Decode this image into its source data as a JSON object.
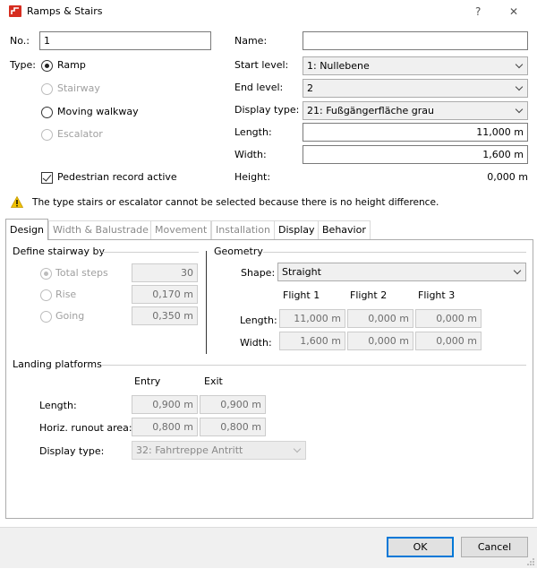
{
  "window": {
    "title": "Ramps & Stairs",
    "help_glyph": "?",
    "close_glyph": "✕"
  },
  "no": {
    "label": "No.:",
    "value": "1"
  },
  "type": {
    "label": "Type:",
    "options": [
      "Ramp",
      "Stairway",
      "Moving walkway",
      "Escalator"
    ],
    "selected": "Ramp"
  },
  "pedestrian": {
    "label": "Pedestrian record active",
    "checked": true
  },
  "right": {
    "name_label": "Name:",
    "name_value": "",
    "start_label": "Start level:",
    "start_value": "1: Nullebene",
    "end_label": "End level:",
    "end_value": "2",
    "display_label": "Display type:",
    "display_value": "21: Fußgängerfläche grau",
    "length_label": "Length:",
    "length_value": "11,000 m",
    "width_label": "Width:",
    "width_value": "1,600 m",
    "height_label": "Height:",
    "height_value": "0,000 m"
  },
  "warning": {
    "icon": "warning-icon",
    "text": "The type stairs or escalator cannot be selected because there is no height difference."
  },
  "tabs": [
    "Design",
    "Width & Balustrade",
    "Movement",
    "Installation",
    "Display",
    "Behavior"
  ],
  "active_tab": "Design",
  "define": {
    "title": "Define stairway by",
    "total_steps_label": "Total steps",
    "total_steps_value": "30",
    "rise_label": "Rise",
    "rise_value": "0,170 m",
    "going_label": "Going",
    "going_value": "0,350 m"
  },
  "geometry": {
    "title": "Geometry",
    "shape_label": "Shape:",
    "shape_value": "Straight",
    "flight_headers": [
      "Flight 1",
      "Flight 2",
      "Flight 3"
    ],
    "length_label": "Length:",
    "length_values": [
      "11,000 m",
      "0,000 m",
      "0,000 m"
    ],
    "width_label": "Width:",
    "width_values": [
      "1,600 m",
      "0,000 m",
      "0,000 m"
    ]
  },
  "landing": {
    "title": "Landing platforms",
    "entry_header": "Entry",
    "exit_header": "Exit",
    "length_label": "Length:",
    "length_entry": "0,900 m",
    "length_exit": "0,900 m",
    "runout_label": "Horiz. runout area:",
    "runout_entry": "0,800 m",
    "runout_exit": "0,800 m",
    "display_label": "Display type:",
    "display_value": "32: Fahrtreppe Antritt"
  },
  "buttons": {
    "ok": "OK",
    "cancel": "Cancel"
  },
  "colors": {
    "accent": "#0078d7",
    "warning": "#f2c200",
    "app_icon": "#d62d20"
  }
}
